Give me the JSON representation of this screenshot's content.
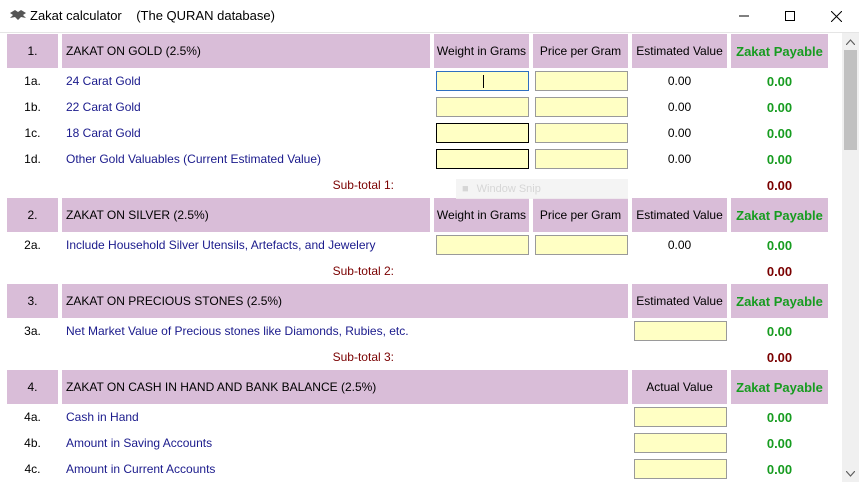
{
  "window": {
    "title": "Zakat calculator    (The QURAN database)"
  },
  "overlay": {
    "snip_label": "Window Snip"
  },
  "col_headers": {
    "weight": "Weight in Grams",
    "price": "Price per Gram",
    "estimated": "Estimated Value",
    "actual": "Actual Value",
    "zakat": "Zakat Payable"
  },
  "sections": [
    {
      "num": "1.",
      "title": "ZAKAT ON GOLD  (2.5%)",
      "rows": [
        {
          "num": "1a.",
          "label": "24 Carat Gold",
          "estimated": "0.00",
          "zakat": "0.00"
        },
        {
          "num": "1b.",
          "label": "22 Carat Gold",
          "estimated": "0.00",
          "zakat": "0.00"
        },
        {
          "num": "1c.",
          "label": "18 Carat Gold",
          "estimated": "0.00",
          "zakat": "0.00"
        },
        {
          "num": "1d.",
          "label": "Other Gold Valuables  (Current Estimated Value)",
          "estimated": "0.00",
          "zakat": "0.00"
        }
      ],
      "subtotal_label": "Sub-total 1:",
      "subtotal": "0.00"
    },
    {
      "num": "2.",
      "title": "ZAKAT ON SILVER  (2.5%)",
      "rows": [
        {
          "num": "2a.",
          "label": "Include Household Silver Utensils, Artefacts, and Jewelery",
          "estimated": "0.00",
          "zakat": "0.00"
        }
      ],
      "subtotal_label": "Sub-total 2:",
      "subtotal": "0.00"
    },
    {
      "num": "3.",
      "title": "ZAKAT ON PRECIOUS STONES  (2.5%)",
      "rows": [
        {
          "num": "3a.",
          "label": "Net Market Value of Precious stones like Diamonds, Rubies, etc.",
          "zakat": "0.00"
        }
      ],
      "subtotal_label": "Sub-total 3:",
      "subtotal": "0.00"
    },
    {
      "num": "4.",
      "title": "ZAKAT ON CASH IN HAND AND BANK BALANCE  (2.5%)",
      "rows": [
        {
          "num": "4a.",
          "label": "Cash in Hand",
          "zakat": "0.00"
        },
        {
          "num": "4b.",
          "label": "Amount in Saving Accounts",
          "zakat": "0.00"
        },
        {
          "num": "4c.",
          "label": "Amount in Current Accounts",
          "zakat": "0.00"
        }
      ]
    }
  ]
}
